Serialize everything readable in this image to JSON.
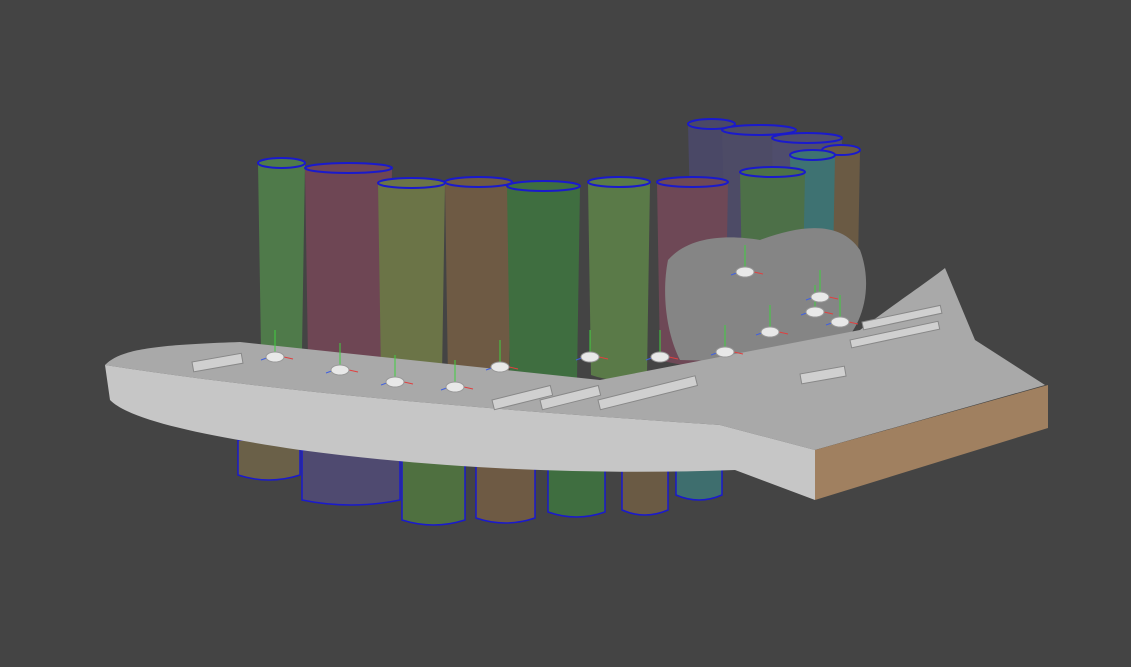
{
  "viewport": {
    "background": "#444444",
    "outline_color": "#1a1acc",
    "plate_top": "#a9a9a9",
    "plate_front": "#c6c6c6",
    "plate_side": "#a08060",
    "gum_gray": "#858585"
  },
  "upper_teeth": [
    {
      "color": "#4f7a4a"
    },
    {
      "color": "#6e4654"
    },
    {
      "color": "#6b7447"
    },
    {
      "color": "#6e5a44"
    },
    {
      "color": "#3f6e40"
    },
    {
      "color": "#5a7a48"
    },
    {
      "color": "#6e4856"
    },
    {
      "color": "#4a4866"
    },
    {
      "color": "#4d4b66"
    },
    {
      "color": "#4d7048"
    },
    {
      "color": "#4f4d6c"
    },
    {
      "color": "#3e7272"
    },
    {
      "color": "#6a5a44"
    }
  ],
  "lower_teeth": [
    {
      "color": "#6a6048"
    },
    {
      "color": "#4f4a70"
    },
    {
      "color": "#4f7040"
    },
    {
      "color": "#6e5a44"
    },
    {
      "color": "#3f6e40"
    },
    {
      "color": "#6a5a44"
    },
    {
      "color": "#3e6e6e"
    }
  ]
}
